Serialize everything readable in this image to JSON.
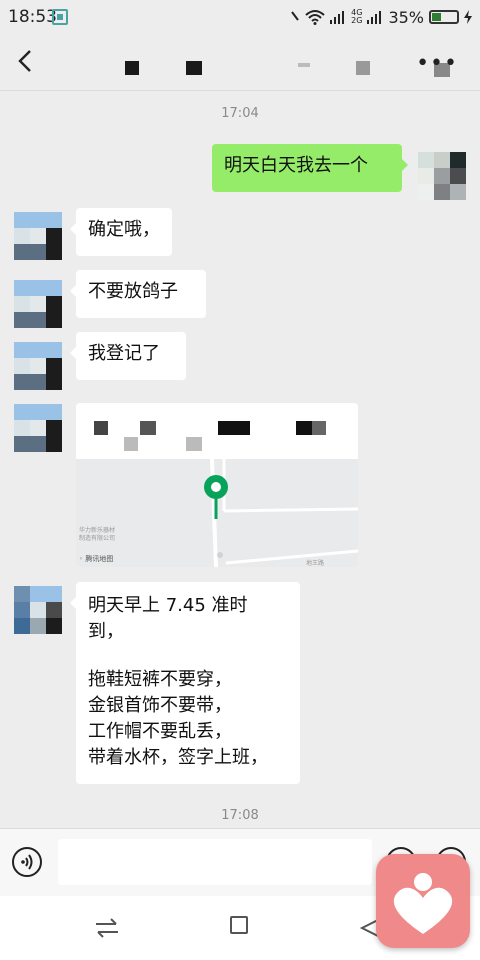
{
  "status_bar": {
    "time": "18:53",
    "network_top": "4G",
    "network_bottom": "2G",
    "battery_percent": "35%",
    "battery_level": 0.35,
    "icons": [
      "scan-icon",
      "mute-icon",
      "wifi-icon",
      "signal-icon",
      "signal-icon",
      "battery-icon",
      "charging-icon"
    ]
  },
  "nav": {
    "back_icon": "chevron-left-icon",
    "more_icon": "more-icon"
  },
  "chat": {
    "timestamp_1": "17:04",
    "messages": [
      {
        "side": "right",
        "text": "明天白天我去一个"
      },
      {
        "side": "left",
        "text": "确定哦，"
      },
      {
        "side": "left",
        "text": "不要放鸽子"
      },
      {
        "side": "left",
        "text": "我登记了"
      },
      {
        "side": "left",
        "type": "location"
      },
      {
        "side": "left",
        "lines": [
          "明天早上 7.45 准时",
          "到，",
          "",
          "拖鞋短裤不要穿，",
          "金银首饰不要带，",
          "工作帽不要乱丢，",
          "带着水杯，签字上班，"
        ]
      }
    ],
    "location": {
      "map_attribution": "腾讯地图",
      "poi_line1": "华力新乐器材",
      "poi_line2": "制造有限公司",
      "road_label": "地王路"
    },
    "timestamp_2": "17:08"
  },
  "input_bar": {
    "value": "",
    "placeholder": "",
    "icons": [
      "voice-icon",
      "emoji-icon",
      "plus-icon"
    ]
  },
  "colors": {
    "background": "#ededed",
    "my_bubble": "#95ec69",
    "their_bubble": "#ffffff",
    "map_pin": "#07a35a",
    "overlay_app": "#f08a8a"
  }
}
